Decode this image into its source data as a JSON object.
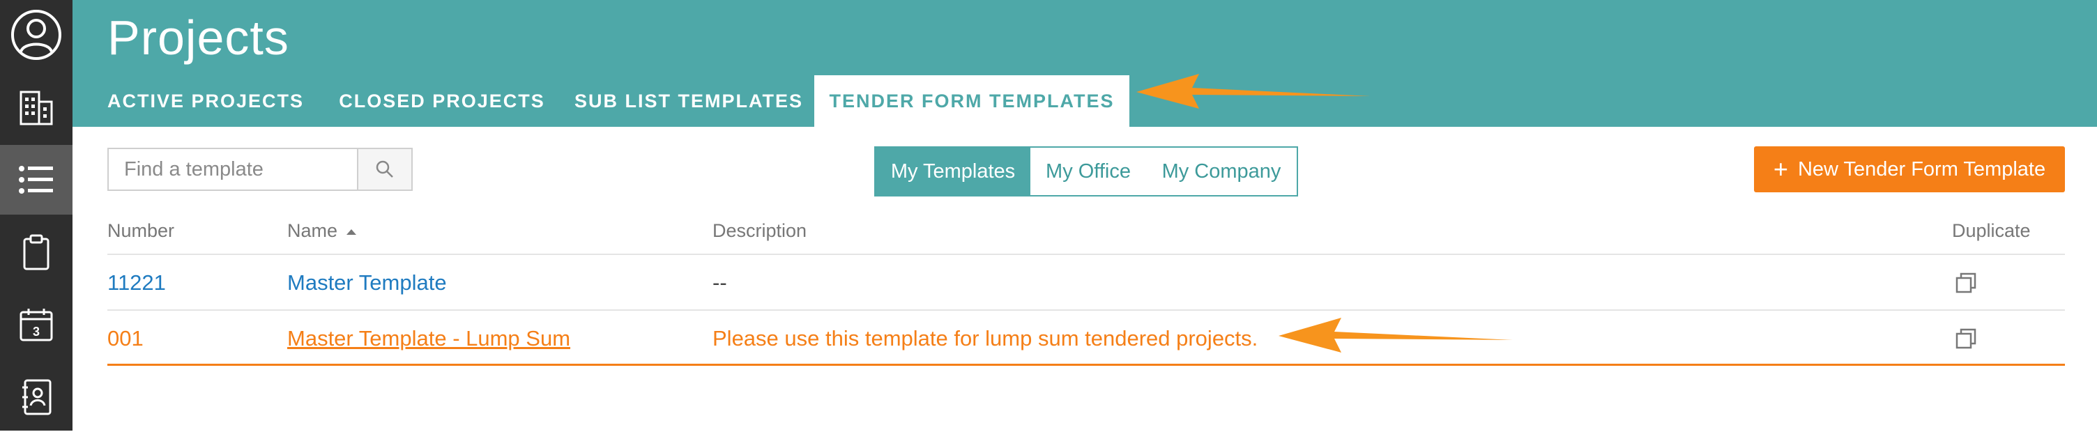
{
  "header": {
    "title": "Projects",
    "tabs": [
      {
        "label": "ACTIVE PROJECTS",
        "active": false
      },
      {
        "label": "CLOSED PROJECTS",
        "active": false
      },
      {
        "label": "SUB LIST TEMPLATES",
        "active": false
      },
      {
        "label": "TENDER FORM TEMPLATES",
        "active": true
      }
    ]
  },
  "sidebar": {
    "items": [
      {
        "icon": "user-icon",
        "active": false
      },
      {
        "icon": "building-icon",
        "active": false
      },
      {
        "icon": "list-icon",
        "active": true
      },
      {
        "icon": "clipboard-icon",
        "active": false
      },
      {
        "icon": "calendar-icon",
        "calendar_day": "3",
        "active": false
      },
      {
        "icon": "address-book-icon",
        "active": false
      }
    ]
  },
  "toolbar": {
    "search_placeholder": "Find a template",
    "search_icon": "search-icon",
    "filters": [
      {
        "label": "My Templates",
        "active": true
      },
      {
        "label": "My Office",
        "active": false
      },
      {
        "label": "My Company",
        "active": false
      }
    ],
    "new_button_label": "New Tender Form Template",
    "new_button_icon": "plus-icon"
  },
  "table": {
    "columns": [
      "Number",
      "Name",
      "Description",
      "Duplicate"
    ],
    "sort_column": "Name",
    "sort_direction": "ascending",
    "rows": [
      {
        "number": "11221",
        "name": "Master Template",
        "description": "--",
        "highlighted": false
      },
      {
        "number": "001",
        "name": "Master Template - Lump Sum",
        "description": "Please use this template for lump sum tendered projects.",
        "highlighted": true
      }
    ]
  },
  "colors": {
    "header_teal": "#4ea8a8",
    "sidebar_dark": "#2e2e2e",
    "accent_orange": "#f57f17",
    "arrow_orange": "#f7941d",
    "link_blue": "#1f7bc0"
  }
}
